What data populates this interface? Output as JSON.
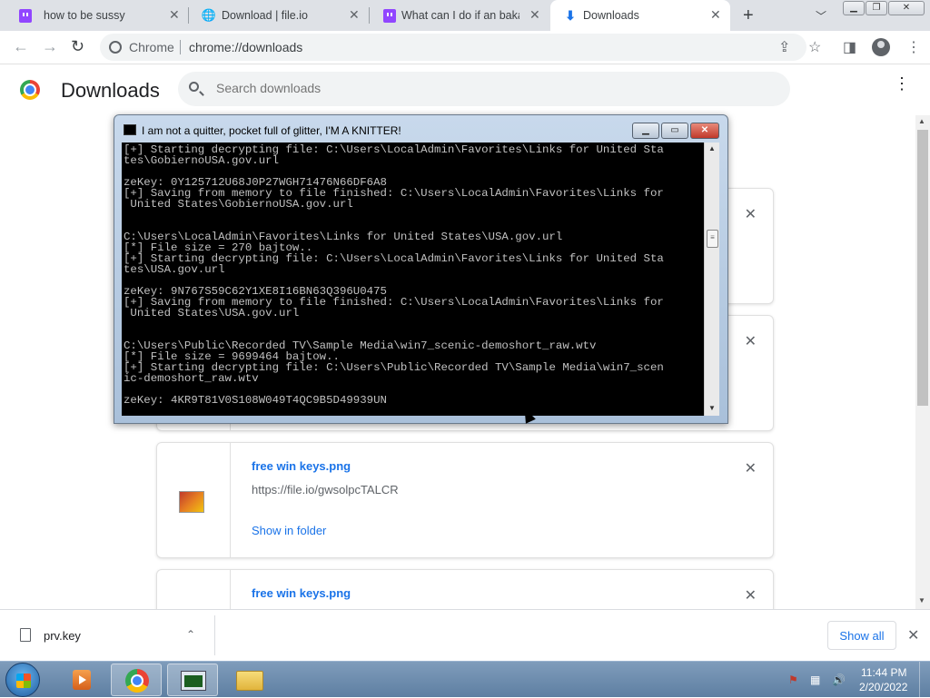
{
  "tabs": [
    {
      "title": "how to be sussy",
      "icon": "twitch-icon"
    },
    {
      "title": "Download | file.io",
      "icon": "globe-icon"
    },
    {
      "title": "What can I do if an baka",
      "icon": "twitch-icon"
    },
    {
      "title": "Downloads",
      "icon": "download-icon",
      "active": true
    }
  ],
  "window_controls": {
    "minimize": "▁",
    "restore": "❐",
    "close": "✕"
  },
  "toolbar": {
    "omnibox_label": "Chrome",
    "url": "chrome://downloads"
  },
  "downloads_page": {
    "title": "Downloads",
    "search_placeholder": "Search downloads",
    "menu": "⋮"
  },
  "download_items": [
    {
      "name": "free win keys.png",
      "url": "https://file.io/gwsolpcTALCR",
      "action": "Show in folder"
    },
    {
      "name": "free win keys.png"
    }
  ],
  "console": {
    "title": "I am not a quitter, pocket full of glitter, I'M A KNITTER!",
    "lines": [
      "[+] Starting decrypting file: C:\\Users\\LocalAdmin\\Favorites\\Links for United Sta",
      "tes\\GobiernoUSA.gov.url",
      "",
      "zeKey: 0Y125712U68J0P27WGH71476N66DF6A8",
      "[+] Saving from memory to file finished: C:\\Users\\LocalAdmin\\Favorites\\Links for",
      " United States\\GobiernoUSA.gov.url",
      "",
      "",
      "C:\\Users\\LocalAdmin\\Favorites\\Links for United States\\USA.gov.url",
      "[*] File size = 270 bajtow..",
      "[+] Starting decrypting file: C:\\Users\\LocalAdmin\\Favorites\\Links for United Sta",
      "tes\\USA.gov.url",
      "",
      "zeKey: 9N767S59C62Y1XE8I16BN63Q396U0475",
      "[+] Saving from memory to file finished: C:\\Users\\LocalAdmin\\Favorites\\Links for",
      " United States\\USA.gov.url",
      "",
      "",
      "C:\\Users\\Public\\Recorded TV\\Sample Media\\win7_scenic-demoshort_raw.wtv",
      "[*] File size = 9699464 bajtow..",
      "[+] Starting decrypting file: C:\\Users\\Public\\Recorded TV\\Sample Media\\win7_scen",
      "ic-demoshort_raw.wtv",
      "",
      "zeKey: 4KR9T81V0S108W049T4QC9B5D49939UN"
    ]
  },
  "shelf": {
    "file_name": "prv.key",
    "show_all": "Show all"
  },
  "taskbar": {
    "time": "11:44 PM",
    "date": "2/20/2022"
  }
}
